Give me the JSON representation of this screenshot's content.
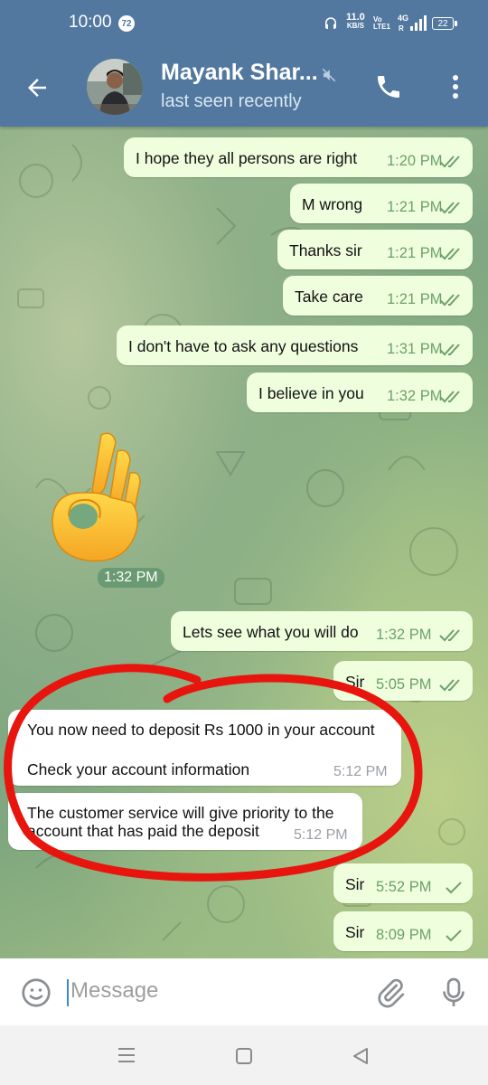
{
  "status_bar": {
    "time": "10:00",
    "notification_count": "72",
    "net_speed_value": "11.0",
    "net_speed_unit": "KB/S",
    "volte_line1": "Vo",
    "volte_line2": "LTE1",
    "network_type": "4G",
    "battery": "22"
  },
  "header": {
    "contact_name": "Mayank Shar...",
    "status": "last seen recently",
    "icons": [
      "back-arrow-icon",
      "mute-icon",
      "phone-icon",
      "more-vert-icon"
    ]
  },
  "messages": [
    {
      "direction": "out",
      "text": "I hope they all persons are right",
      "time": "1:20 PM",
      "status": "read"
    },
    {
      "direction": "out",
      "text": "M wrong",
      "time": "1:21 PM",
      "status": "read"
    },
    {
      "direction": "out",
      "text": "Thanks sir",
      "time": "1:21 PM",
      "status": "read"
    },
    {
      "direction": "out",
      "text": "Take care",
      "time": "1:21 PM",
      "status": "read"
    },
    {
      "direction": "out",
      "text": "I don't have to ask any questions",
      "time": "1:31 PM",
      "status": "read"
    },
    {
      "direction": "out",
      "text": "I believe in you",
      "time": "1:32 PM",
      "status": "read"
    },
    {
      "direction": "in",
      "type": "sticker",
      "emoji": "ok-hand-emoji",
      "time": "1:32 PM"
    },
    {
      "direction": "out",
      "text": "Lets see what you will do",
      "time": "1:32 PM",
      "status": "read"
    },
    {
      "direction": "out",
      "text": "Sir",
      "time": "5:05 PM",
      "status": "read"
    },
    {
      "direction": "in",
      "line1": "You now need to deposit Rs 1000 in your account",
      "line2": "Check your account information",
      "time": "5:12 PM"
    },
    {
      "direction": "in",
      "line1": "The customer service will give priority to the",
      "line2": "account that has paid the deposit",
      "time": "5:12 PM"
    },
    {
      "direction": "out",
      "text": "Sir",
      "time": "5:52 PM",
      "status": "sent"
    },
    {
      "direction": "out",
      "text": "Sir",
      "time": "8:09 PM",
      "status": "sent"
    }
  ],
  "annotation": {
    "color": "#e8140e",
    "shape": "hand-drawn-circle"
  },
  "input": {
    "placeholder": "Message",
    "value": ""
  },
  "colors": {
    "header": "#52789f",
    "outgoing_bubble": "#effedd",
    "read_check": "#6da06a"
  }
}
